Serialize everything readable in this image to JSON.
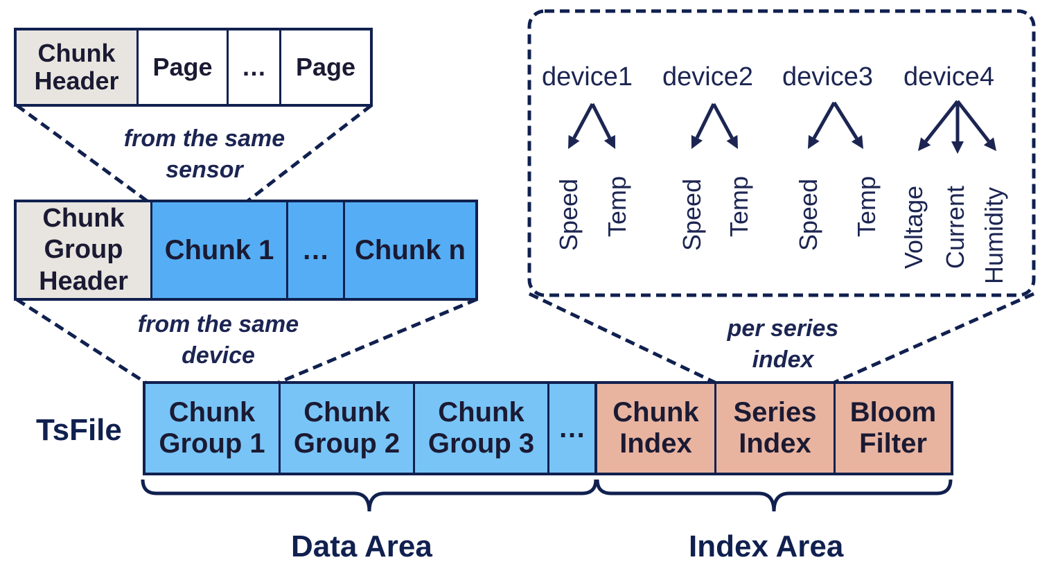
{
  "chunk": {
    "cells": [
      "Chunk\nHeader",
      "Page",
      "…",
      "Page"
    ],
    "caption": "from the same\nsensor"
  },
  "chunk_group": {
    "cells": [
      "Chunk\nGroup\nHeader",
      "Chunk 1",
      "…",
      "Chunk n"
    ],
    "caption": "from the same\ndevice"
  },
  "tsfile": {
    "label": "TsFile",
    "data_cells": [
      "Chunk\nGroup 1",
      "Chunk\nGroup 2",
      "Chunk\nGroup 3",
      "…"
    ],
    "index_cells": [
      "Chunk\nIndex",
      "Series\nIndex",
      "Bloom\nFilter"
    ],
    "data_area_label": "Data Area",
    "index_area_label": "Index Area"
  },
  "index_detail": {
    "caption": "per series\nindex",
    "devices": [
      {
        "name": "device1",
        "series": [
          "Speed",
          "Temp"
        ]
      },
      {
        "name": "device2",
        "series": [
          "Speed",
          "Temp"
        ]
      },
      {
        "name": "device3",
        "series": [
          "Speed",
          "Temp"
        ]
      },
      {
        "name": "device4",
        "series": [
          "Voltage",
          "Current",
          "Humidity"
        ]
      }
    ]
  },
  "colors": {
    "outline": "#10204f",
    "header_gray": "#e8e5e0",
    "chunk_blue": "#55aef5",
    "group_blue": "#78c4f7",
    "index_salmon": "#e8b4a0"
  }
}
